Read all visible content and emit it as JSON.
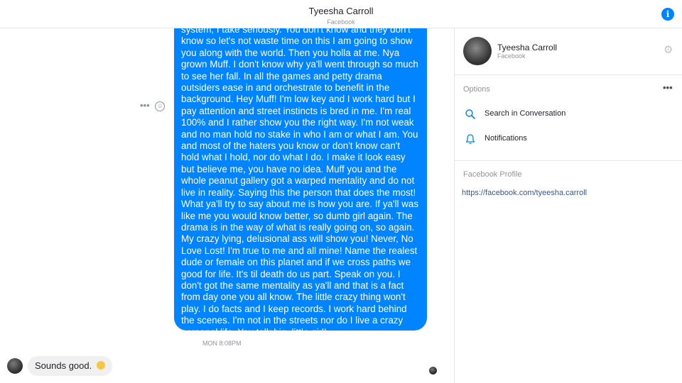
{
  "header": {
    "title": "Tyeesha Carroll",
    "subtitle": "Facebook",
    "info_icon": "info-icon"
  },
  "conversation": {
    "message_text": "system, I take seriously. You don't know and they don't know so let's not waste time on this I am going to show you along with the world. Then you holla at me. Nya grown Muff. I don't know why ya'll went through so much to see her fall. In all the games and petty drama outsiders ease in and orchestrate to benefit in the background. Hey Muff! I'm low key and I work hard but I pay attention and street instincts is bred in me. I'm real 100% and I rather show you the right way. I'm not weak and no man hold no stake in who I am or what I am. You and most of the haters you know or don't know can't  hold what I hold, nor do what I do. I make it look easy but believe me, you have no idea. Muff you and the whole peanut gallery got a warped mentality and do not live in reality. Saying this the person that does the most! What ya'll try to say about me is how you are. If ya'll was like me you would know better, so dumb girl again. The drama is in the way of what is really going on, so again. My crazy lying, delusional ass will show you! Never, No Love Lost! I'm true to me and all mine! Name the realest dude or female on this planet and if we cross paths we good for life. It's til death do us part. Speak on you. I don't got the same mentality as ya'll and that is a fact from day one you all know. The little crazy thing won't play. I do facts and I keep records. I work hard behind the scenes. I'm not in the streets nor do I live a crazy personal life. You talk big, little girl!",
    "actions_dots": "•••",
    "emoji_glyph": "☺",
    "timestamp": "MON 8:08PM",
    "reply_text": "Sounds good.",
    "bubble_color": "#0084ff"
  },
  "sidebar": {
    "contact_name": "Tyeesha Carroll",
    "contact_source": "Facebook",
    "settings_icon": "gear-icon",
    "options_header": "Options",
    "more_dots": "•••",
    "options": [
      {
        "label": "Search in Conversation",
        "icon": "search-icon"
      },
      {
        "label": "Notifications",
        "icon": "bell-icon"
      }
    ],
    "profile_header": "Facebook Profile",
    "profile_link": "https://facebook.com/tyeesha.carroll"
  }
}
